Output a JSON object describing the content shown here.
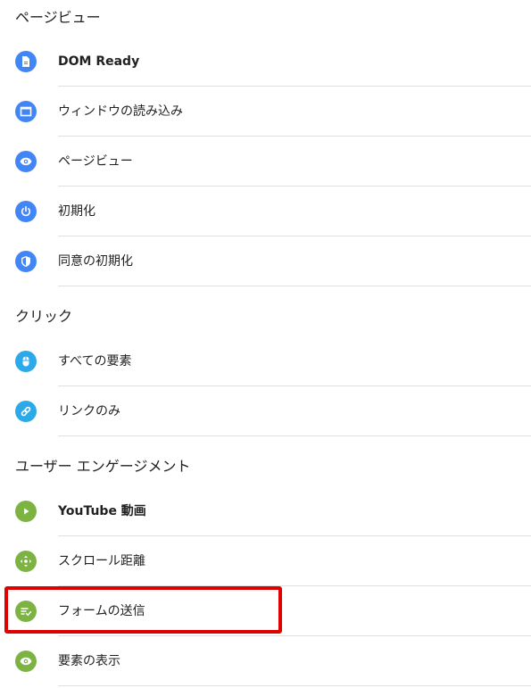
{
  "colors": {
    "blue": "#4285f4",
    "light_blue": "#2ba9e8",
    "green": "#7cb342",
    "highlight": "#e00000"
  },
  "sections": [
    {
      "title": "ページビュー",
      "items": [
        {
          "label": "DOM Ready",
          "icon": "document-icon"
        },
        {
          "label": "ウィンドウの読み込み",
          "icon": "window-icon"
        },
        {
          "label": "ページビュー",
          "icon": "eye-icon"
        },
        {
          "label": "初期化",
          "icon": "power-icon"
        },
        {
          "label": "同意の初期化",
          "icon": "shield-icon"
        }
      ]
    },
    {
      "title": "クリック",
      "items": [
        {
          "label": "すべての要素",
          "icon": "mouse-icon"
        },
        {
          "label": "リンクのみ",
          "icon": "link-icon"
        }
      ]
    },
    {
      "title": "ユーザー エンゲージメント",
      "items": [
        {
          "label": "YouTube 動画",
          "icon": "play-icon"
        },
        {
          "label": "スクロール距離",
          "icon": "scroll-arrows-icon"
        },
        {
          "label": "フォームの送信",
          "icon": "form-submit-icon"
        },
        {
          "label": "要素の表示",
          "icon": "eye-icon"
        }
      ]
    }
  ]
}
